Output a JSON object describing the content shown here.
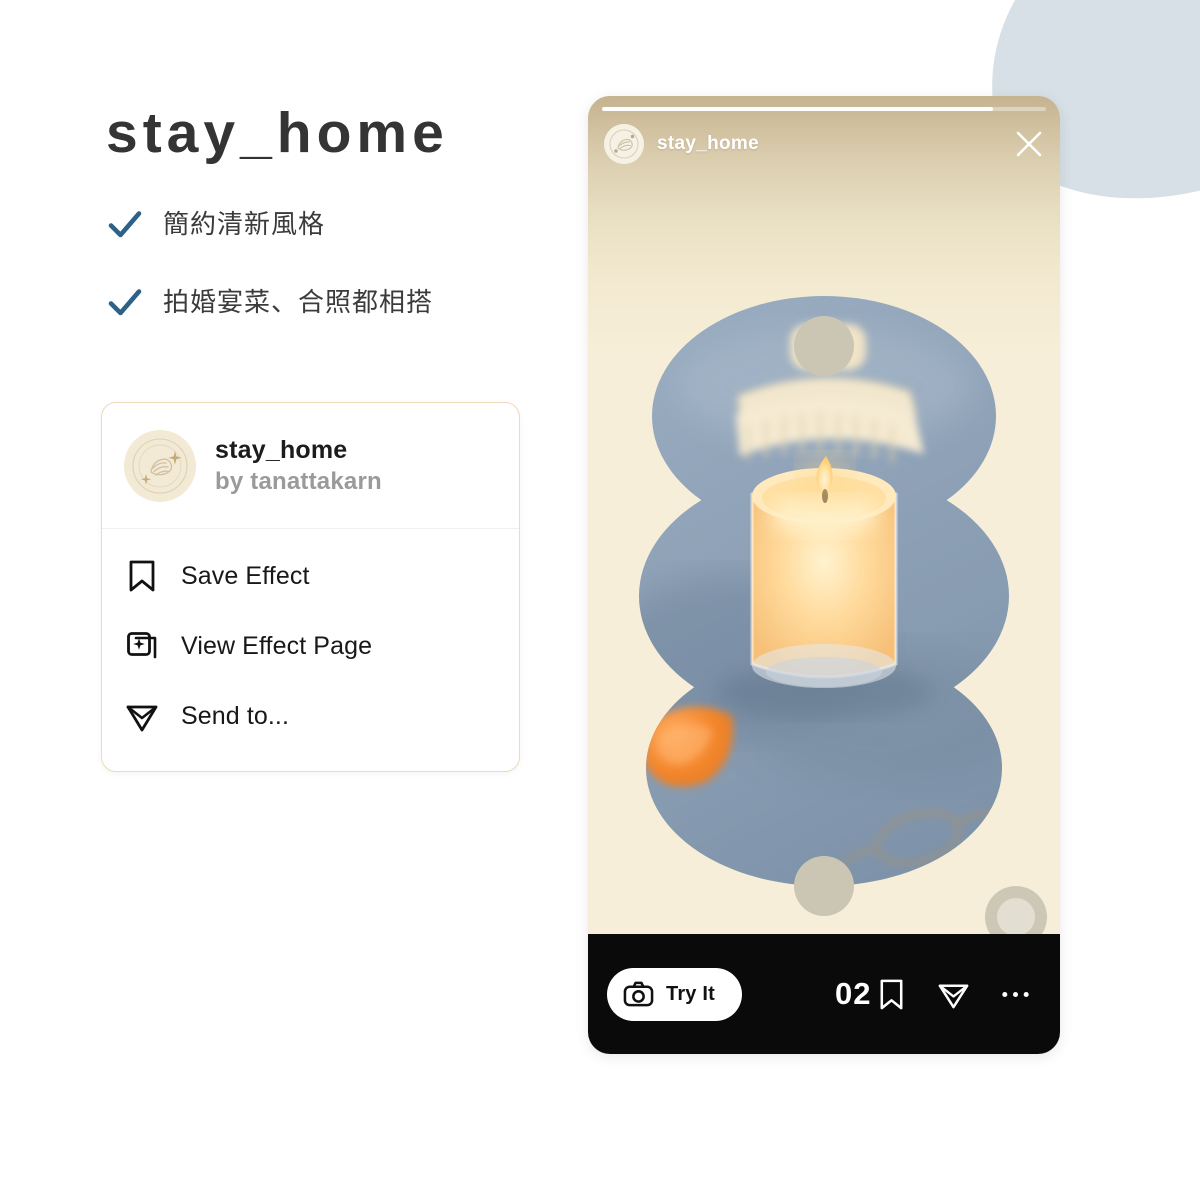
{
  "page": {
    "background_color": "#ffffff",
    "accent_check_color": "#2e6187",
    "card_border_color": "#f0d9bc",
    "blob_color": "#d6e0e6"
  },
  "headline": "stay_home",
  "bullets": [
    {
      "icon": "check-icon",
      "text": "簡約清新風格"
    },
    {
      "icon": "check-icon",
      "text": "拍婚宴菜、合照都相搭"
    }
  ],
  "effect_card": {
    "avatar_icon": "effect-avatar-icon",
    "title": "stay_home",
    "author": "by tanattakarn",
    "menu": [
      {
        "icon": "bookmark-icon",
        "label": "Save Effect"
      },
      {
        "icon": "effect-page-icon",
        "label": "View Effect Page"
      },
      {
        "icon": "send-icon",
        "label": "Send to..."
      }
    ]
  },
  "story": {
    "progress_percent": 88,
    "avatar_icon": "story-avatar-icon",
    "username": "stay_home",
    "close_icon": "close-icon",
    "media": {
      "description": "lit candle in glass jar on blue-grey surface with brush, orange bowl and eyeglasses, masked by three overlapping ellipses",
      "background_top_color": "#c5b390",
      "background_bottom_color": "#f6eed8",
      "surface_color": "#8fa3b8",
      "candle_glow_color": "#ffcf80",
      "accent_bowl_color": "#f08a33"
    },
    "action_bar": {
      "try_button": {
        "icon": "camera-icon",
        "label": "Try It"
      },
      "counter": "02",
      "actions": [
        {
          "icon": "bookmark-icon"
        },
        {
          "icon": "send-icon"
        },
        {
          "icon": "more-options-icon"
        }
      ]
    }
  }
}
